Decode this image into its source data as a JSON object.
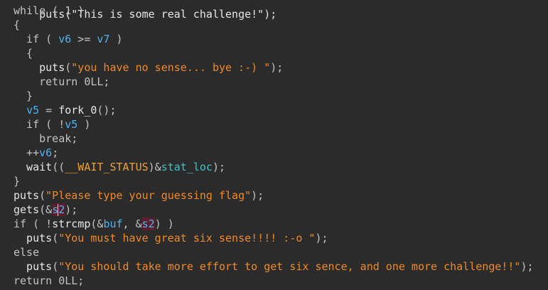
{
  "colors": {
    "background": "#2b2b2b",
    "default_text": "#c3c3c3",
    "identifier": "#4fb3f0",
    "string": "#f08a24",
    "global": "#39c4c4",
    "highlight": "#5a1e2c"
  },
  "code": {
    "l0": {
      "t0": "puts(\"This is some real challenge!\");"
    },
    "l1": {
      "t0": "while",
      "t1": " ( ",
      "t2": "1",
      "t3": " )"
    },
    "l2": {
      "t0": "{"
    },
    "l3": {
      "t0": "  if",
      "t1": " ( ",
      "t2": "v6",
      "t3": " >= ",
      "t4": "v7",
      "t5": " )"
    },
    "l4": {
      "t0": "  {"
    },
    "l5": {
      "t0": "    puts",
      "t1": "(",
      "t2": "\"you have no sense... bye :-) \"",
      "t3": ");"
    },
    "l6": {
      "t0": "    return",
      "t1": " 0LL;"
    },
    "l7": {
      "t0": "  }"
    },
    "l8": {
      "t0": "  ",
      "t1": "v5",
      "t2": " = ",
      "t3": "fork_0",
      "t4": "();"
    },
    "l9": {
      "t0": "  if",
      "t1": " ( !",
      "t2": "v5",
      "t3": " )"
    },
    "l10": {
      "t0": "    break;"
    },
    "l11": {
      "t0": "  ++",
      "t1": "v6",
      "t2": ";"
    },
    "l12": {
      "t0": "  wait",
      "t1": "((",
      "t2": "__WAIT_STATUS",
      "t3": ")&",
      "t4": "stat_loc",
      "t5": ");"
    },
    "l13": {
      "t0": "}"
    },
    "l14": {
      "t0": "puts",
      "t1": "(",
      "t2": "\"Please type your guessing flag\"",
      "t3": ");"
    },
    "l15": {
      "t0": "gets",
      "t1": "(&",
      "t2": "s",
      "t3": "2",
      "t4": ");"
    },
    "l16": {
      "t0": "if",
      "t1": " ( !",
      "t2": "strcmp",
      "t3": "(&",
      "t4": "buf",
      "t5": ", &",
      "t6": "s2",
      "t7": ") )"
    },
    "l17": {
      "t0": "  puts",
      "t1": "(",
      "t2": "\"You must have great six sense!!!! :-o \"",
      "t3": ");"
    },
    "l18": {
      "t0": "else"
    },
    "l19": {
      "t0": "  puts",
      "t1": "(",
      "t2": "\"You should take more effort to get six sence, and one more challenge!!\"",
      "t3": ");"
    },
    "l20": {
      "t0": "return",
      "t1": " 0LL;"
    }
  }
}
